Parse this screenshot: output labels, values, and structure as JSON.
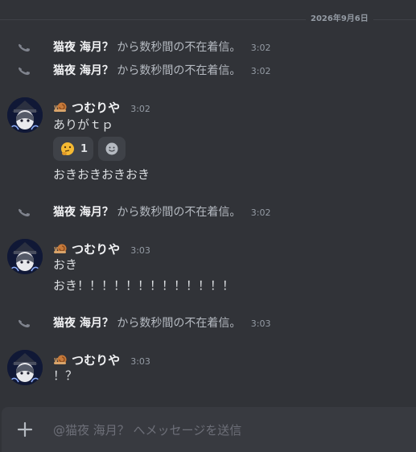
{
  "date_divider": "2026年9月6日",
  "system": {
    "caller": "猫夜 海月？",
    "missed_call_text": "から数秒間の不在着信。",
    "times": [
      "3:02",
      "3:02",
      "3:02",
      "3:03"
    ]
  },
  "author": {
    "name": "つむりや",
    "emoji_icon": "snail-icon"
  },
  "groups": [
    {
      "time": "3:02",
      "lines": [
        "ありがｔｐ",
        "おきおきおきおき"
      ],
      "reactions": [
        {
          "icon": "thinking-face-emoji",
          "count": "1"
        },
        {
          "icon": "add-reaction-icon"
        }
      ]
    },
    {
      "time": "3:03",
      "lines": [
        "おき",
        "おき！！！！！！！！！！！！！"
      ]
    },
    {
      "time": "3:03",
      "lines": [
        "！？"
      ]
    }
  ],
  "input": {
    "placeholder": "@猫夜 海月？ へメッセージを送信"
  },
  "colors": {
    "background": "#313338",
    "input_background": "#383a40",
    "text_muted": "#949ba4"
  }
}
